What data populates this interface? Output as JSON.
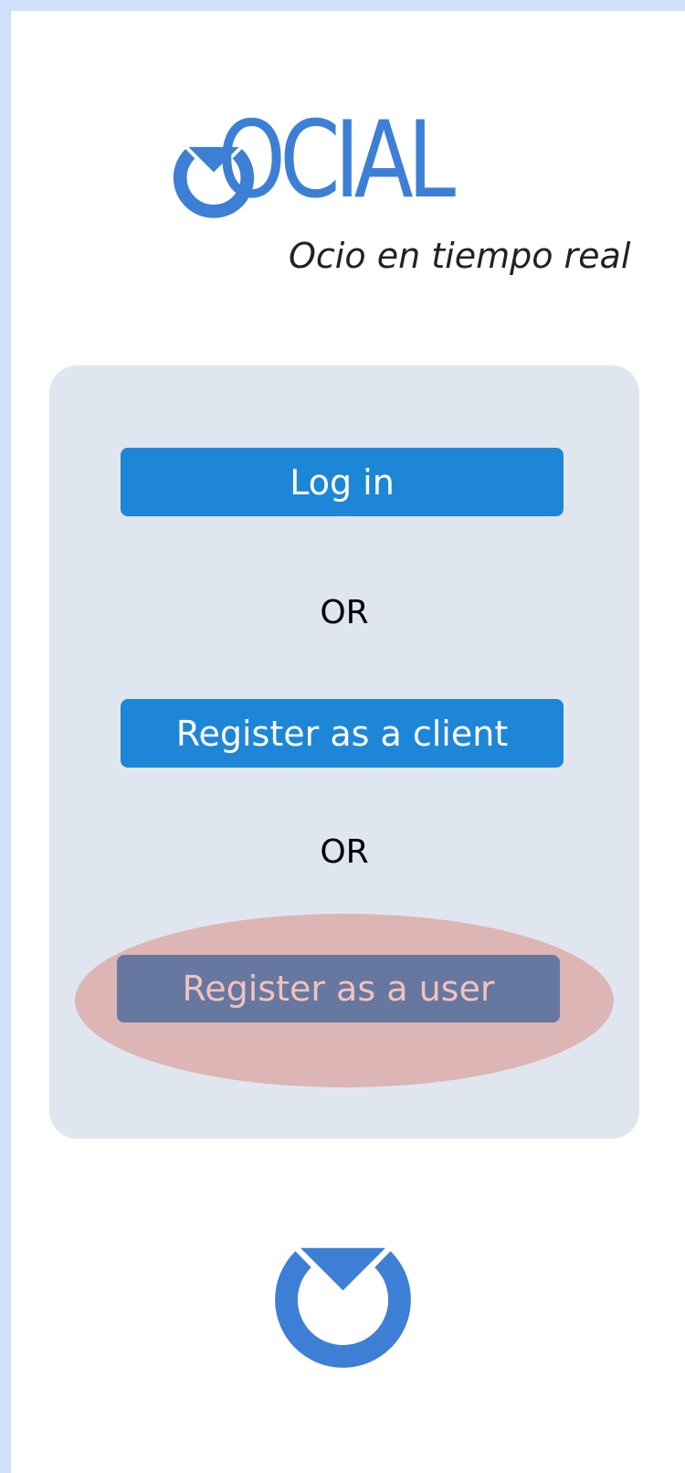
{
  "app": {
    "logo_text": "OCIAL",
    "tagline": "Ocio en tiempo real"
  },
  "actions": {
    "login_label": "Log in",
    "or_1": "OR",
    "register_client_label": "Register as a client",
    "or_2": "OR",
    "register_user_label": "Register as a user"
  },
  "colors": {
    "page_background": "#cfe0fb",
    "brand_blue": "#3e7fd6",
    "primary_button": "#1e86d6",
    "card_background": "#e0e6ef",
    "highlight": "#dcb5b4",
    "highlighted_button": "#6677a0",
    "highlighted_button_text": "#f2c2bd"
  },
  "icons": {
    "logo_mark": "clock-check-icon",
    "footer_mark": "clock-check-icon"
  }
}
